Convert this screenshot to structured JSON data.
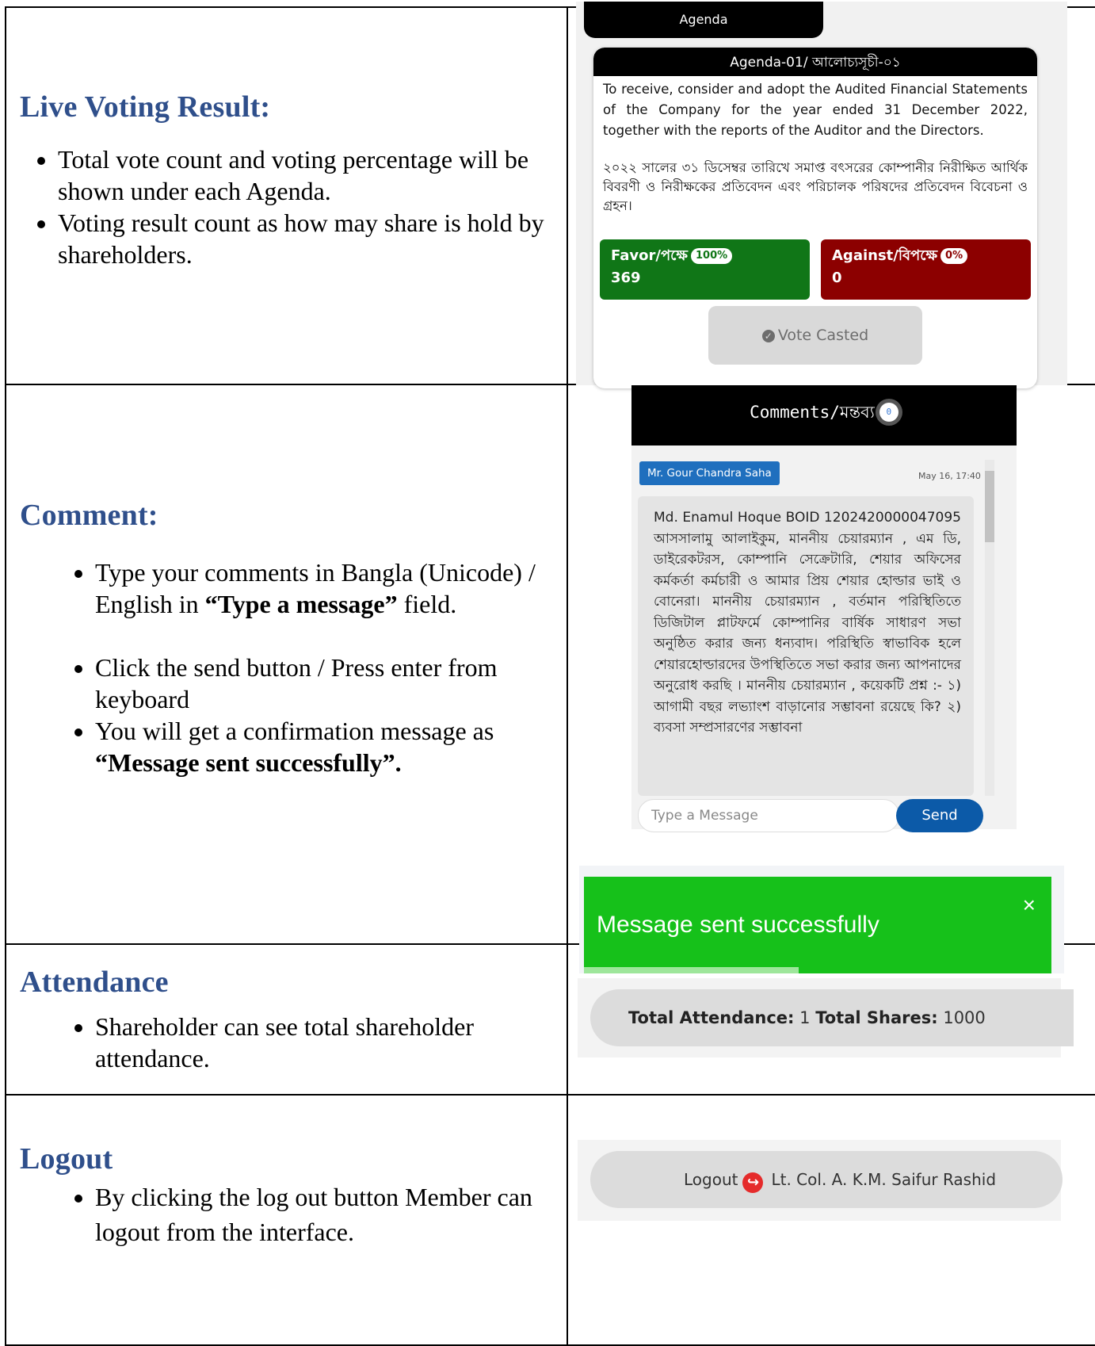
{
  "sections": {
    "live_voting": {
      "heading": "Live Voting Result:",
      "bullets": [
        "Total vote count and voting percentage will be shown under each Agenda.",
        "Voting result count as how may share is hold by shareholders."
      ],
      "panel": {
        "tab_label": "Agenda",
        "card_title": "Agenda-01/ আলোচ্যসূচী-০১",
        "text_en": "To receive, consider and adopt the Audited Financial Statements of the Company for the year ended 31 December 2022, together with the reports of the Auditor and the Directors.",
        "text_bn": "২০২২ সালের ৩১ ডিসেম্বর তারিখে সমাপ্ত বৎসরের কোম্পানীর নিরীক্ষিত আর্থিক বিবরণী ও নিরীক্ষকের প্রতিবেদন এবং পরিচালক পরিষদের প্রতিবেদন বিবেচনা ও গ্রহন।",
        "favor_label": "Favor/পক্ষে",
        "favor_pct": "100%",
        "favor_count": "369",
        "against_label": "Against/বিপক্ষে",
        "against_pct": "0%",
        "against_count": "0",
        "vote_button": "Vote Casted"
      }
    },
    "comment": {
      "heading": "Comment:",
      "bullet1_a": "Type your comments in Bangla (Unicode) / English in ",
      "bullet1_b": "“Type a message”",
      "bullet1_c": " field.",
      "bullet2": "Click the send button / Press enter from keyboard",
      "bullet3_a": "You will get a confirmation message as ",
      "bullet3_b": "“Message sent successfully”.",
      "panel": {
        "header": "Comments/মন্তব্য",
        "count": "0",
        "author": "Mr. Gour Chandra Saha",
        "time": "May 16, 17:40",
        "message": "Md. Enamul Hoque BOID 1202420000047095 আসসালামু আলাইকুম, মাননীয় চেয়ারম্যান , এম ডি, ডাইরেকটরস, কোম্পানি সেক্রেটারি, শেয়ার অফিসের কর্মকর্তা কর্মচারী ও আমার প্রিয় শেয়ার হোল্ডার ভাই ও বোনেরা। মাননীয় চেয়ারম্যান , বর্তমান পরিস্থিতিতে ডিজিটাল প্লাটফর্মে কোম্পানির বার্ষিক সাধারণ সভা অনুষ্ঠিত করার জন্য ধন্যবাদ। পরিস্থিতি স্বাভাবিক হলে শেয়ারহোল্ডারদের উপস্থিতিতে সভা করার জন্য আপনাদের অনুরোধ করছি । মাননীয় চেয়ারম্যান , কয়েকটি প্রশ্ন :- ১) আগামী বছর লভ্যাংশ বাড়ানোর সম্ভাবনা রয়েছে কি? ২) ব্যবসা সম্প্রসারণের সম্ভাবনা",
        "input_placeholder": "Type a Message",
        "send_button": "Send",
        "toast_text": "Message sent successfully",
        "toast_close": "×",
        "toast_progress": 0.46
      }
    },
    "attendance": {
      "heading": "Attendance",
      "bullet": "Shareholder can see total shareholder attendance.",
      "panel": {
        "attendance_label": "Total Attendance:",
        "attendance_value": "1",
        "shares_label": "Total Shares:",
        "shares_value": "1000"
      }
    },
    "logout": {
      "heading": "Logout",
      "bullet": "By clicking the log out button Member can logout from the interface.",
      "panel": {
        "logout_label": "Logout",
        "user_name": "Lt. Col. A. K.M. Saifur Rashid"
      }
    }
  }
}
